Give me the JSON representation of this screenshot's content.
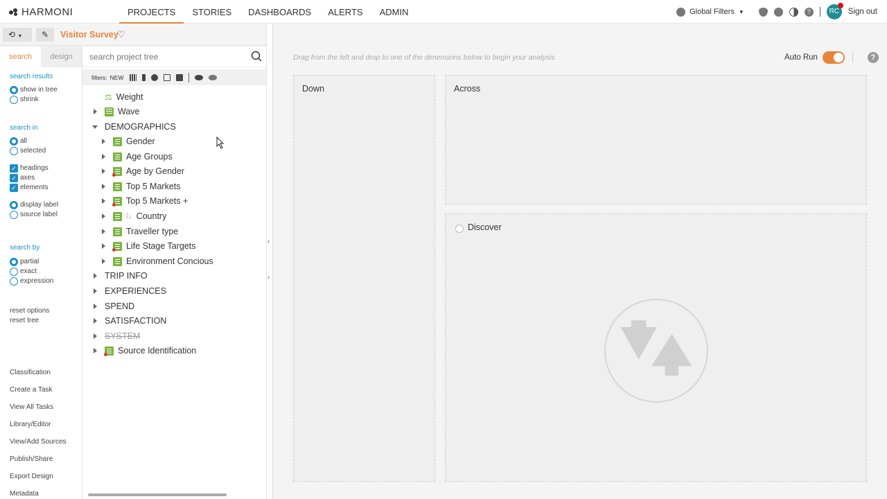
{
  "brand": "HARMONI",
  "nav": [
    "PROJECTS",
    "STORIES",
    "DASHBOARDS",
    "ALERTS",
    "ADMIN"
  ],
  "top_right": {
    "global_filters": "Global Filters",
    "avatar_initials": "RC",
    "sign_out": "Sign out"
  },
  "project": {
    "title": "Visitor Survey"
  },
  "left_tabs": {
    "search": "search",
    "design": "design"
  },
  "search_results": {
    "title": "search results",
    "options": [
      "show in tree",
      "shrink"
    ]
  },
  "search_in": {
    "title": "search in",
    "radios": [
      "all",
      "selected"
    ],
    "checks": [
      "headings",
      "axes",
      "elements"
    ],
    "label_radios": [
      "display label",
      "source label"
    ]
  },
  "search_by": {
    "title": "search by",
    "options": [
      "partial",
      "exact",
      "expression"
    ]
  },
  "reset": [
    "reset options",
    "reset tree"
  ],
  "links": [
    "Classification",
    "Create a Task",
    "View All Tasks",
    "Library/Editor",
    "View/Add Sources",
    "Publish/Share",
    "Export Design",
    "Metadata"
  ],
  "tree_search": {
    "placeholder": "search project tree"
  },
  "filters": {
    "label": "filters:",
    "new_label": "NEW"
  },
  "tree": {
    "weight": "Weight",
    "wave": "Wave",
    "demographics": "DEMOGRAPHICS",
    "children": [
      "Gender",
      "Age Groups",
      "Age by Gender",
      "Top 5 Markets",
      "Top 5 Markets +",
      "Country",
      "Traveller type",
      "Life Stage Targets",
      "Environment Concious"
    ],
    "country_prefix": "⁞↓",
    "groups": [
      "TRIP INFO",
      "EXPERIENCES",
      "SPEND",
      "SATISFACTION",
      "SYSTEM"
    ],
    "source_id": "Source Identification"
  },
  "main": {
    "hint": "Drag from the left and drop to one of the dimensions below to begin your analysis",
    "auto_run": "Auto Run",
    "down": "Down",
    "across": "Across",
    "discover": "Discover"
  },
  "colors": {
    "accent": "#e8833a",
    "link_blue": "#1a8fc6",
    "node_green": "#7cb342"
  }
}
